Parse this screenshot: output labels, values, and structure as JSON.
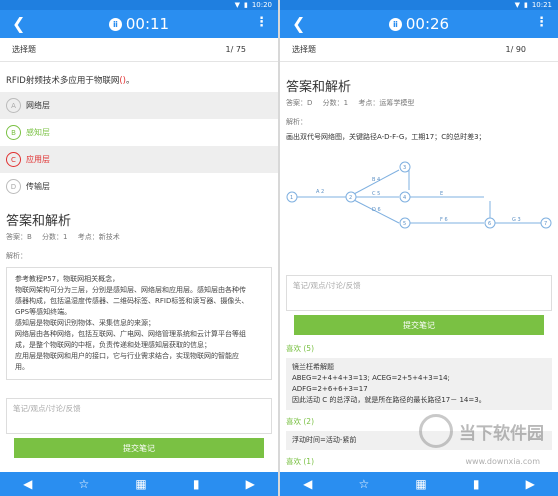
{
  "left": {
    "status_time": "10:20",
    "timer": "00:11",
    "qtype": "选择题",
    "progress": "1/ 75",
    "question_prefix": "RFID射频技术多应用于物联网",
    "question_blank": "()",
    "question_suffix": "。",
    "options": [
      {
        "letter": "A",
        "text": "网络层"
      },
      {
        "letter": "B",
        "text": "感知层"
      },
      {
        "letter": "C",
        "text": "应用层"
      },
      {
        "letter": "D",
        "text": "传输层"
      }
    ],
    "section_title": "答案和解析",
    "answer": "答案：B",
    "score": "分数：1",
    "topic": "考点：新技术",
    "analysis_label": "解析：",
    "analysis_lines": [
      "参考教程P57，物联网相关概念，",
      "物联网架构可分为三层，分别是感知层、网络层和应用层。感知层由各种传",
      "感器构成，包括温湿度传感器、二维码标签、RFID标签和读写器、摄像头、",
      "GPS等感知终端。",
      "感知层是物联网识别物体、采集信息的来源；",
      "网络层由各种网络，包括互联网、广电网、网络管理系统和云计算平台等组",
      "成，是整个物联网的中枢，负责传递和处理感知层获取的信息；",
      "应用层是物联网和用户的接口，它与行业需求结合，实现物联网的智能应",
      "用。"
    ],
    "notes_placeholder": "笔记/观点/讨论/反馈",
    "submit_label": "提交笔记"
  },
  "right": {
    "status_time": "10:21",
    "timer": "00:26",
    "qtype": "选择题",
    "progress": "1/ 90",
    "section_title": "答案和解析",
    "answer": "答案：D",
    "score": "分数：1",
    "topic": "考点：运筹学模型",
    "analysis_label": "解析：",
    "analysis_text": "画出双代号网络图，关键路径A-D-F-G，工期17；C的总时差3；",
    "diagram": {
      "nodes": [
        "1",
        "2",
        "3",
        "4",
        "5",
        "6",
        "7"
      ],
      "edges": [
        "A 2",
        "B 4",
        "C 5",
        "D 6",
        "E",
        "F 6",
        "G 3"
      ]
    },
    "notes_placeholder": "笔记/观点/讨论/反馈",
    "submit_label": "提交笔记",
    "likes": [
      {
        "title": "喜欢 (5)",
        "lines": [
          "镜兰枉希解题",
          "ABEG=2+4+4+3=13; ACEG=2+5+4+3=14;",
          "ADFG=2+6+6+3=17",
          "因此活动 C 的总浮动，就是所在路径的最长路径17－ 14=3。"
        ]
      },
      {
        "title": "喜欢 (2)",
        "lines": [
          "浮动时间=活动-紧前"
        ]
      },
      {
        "title": "喜欢 (1)",
        "lines": []
      }
    ]
  },
  "watermark": {
    "text": "当下软件园",
    "url": "www.downxia.com"
  },
  "colors": {
    "primary": "#2a8ef0",
    "accent_green": "#7ac143",
    "wrong_red": "#e03030"
  }
}
